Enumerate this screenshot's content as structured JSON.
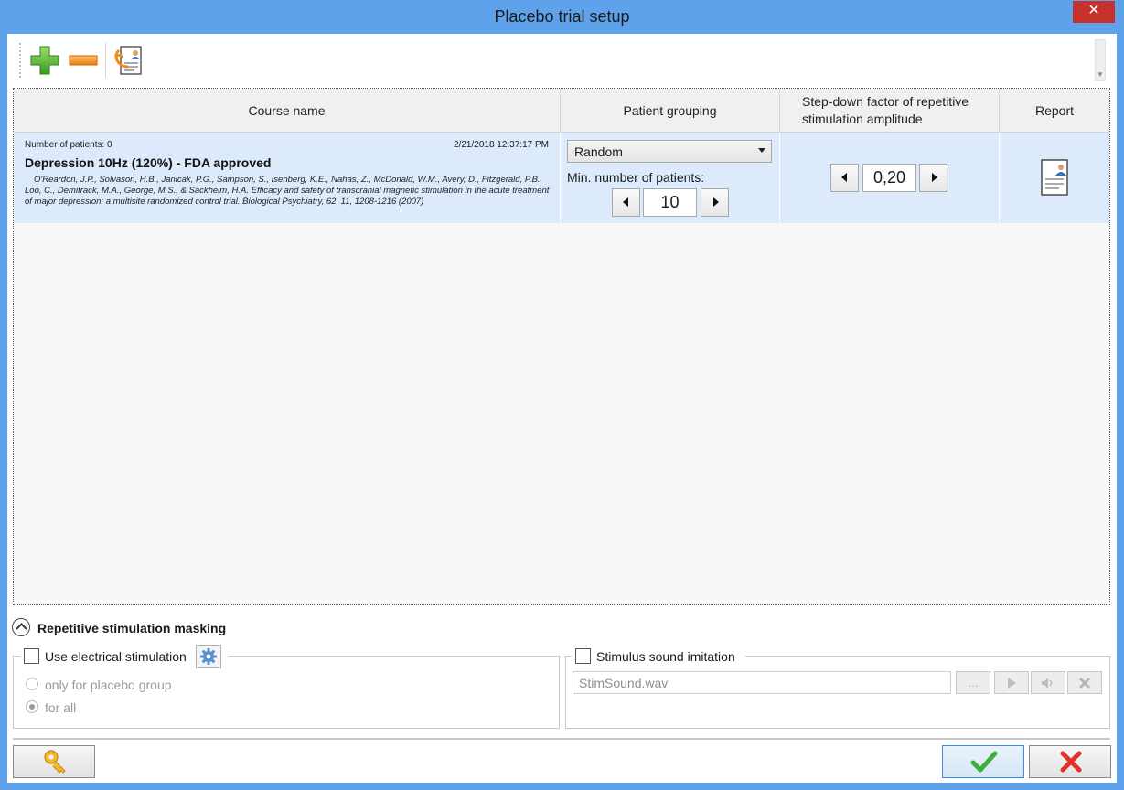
{
  "window": {
    "title": "Placebo trial setup",
    "close_glyph": "✕"
  },
  "toolbar": {
    "add_icon": "plus-icon",
    "remove_icon": "minus-icon",
    "patient_report_icon": "patient-report-icon"
  },
  "grid": {
    "columns": [
      "Course name",
      "Patient grouping",
      "Step-down factor of repetitive stimulation amplitude",
      "Report"
    ],
    "rows": [
      {
        "patients_label": "Number of patients:  0",
        "date": "2/21/2018 12:37:17 PM",
        "course_name": "Depression 10Hz (120%) - FDA approved",
        "citation": "O'Reardon, J.P., Solvason, H.B., Janicak, P.G., Sampson, S., Isenberg, K.E., Nahas, Z., McDonald, W.M., Avery, D., Fitzgerald, P.B., Loo, C., Demitrack, M.A., George, M.S., & Sackheim, H.A. Efficacy and safety of transcranial magnetic stimulation in the acute treatment of major depression: a multisite randomized control trial. Biological Psychiatry, 62, 11, 1208-1216 (2007)",
        "grouping": "Random",
        "min_patients_label": "Min. number of patients:",
        "min_patients": "10",
        "step_down": "0,20"
      }
    ]
  },
  "masking": {
    "title": "Repetitive stimulation masking",
    "electrical": {
      "label": "Use electrical stimulation",
      "options": [
        "only for placebo group",
        "for all"
      ],
      "selected": "for all"
    },
    "sound": {
      "label": "Stimulus sound imitation",
      "file": "StimSound.wav",
      "browse_label": "..."
    }
  },
  "footer": {
    "key_icon": "key-icon",
    "ok_icon": "checkmark-icon",
    "cancel_icon": "cross-icon"
  },
  "colors": {
    "accent": "#5da2ea",
    "row_selected": "#dceafc",
    "close": "#c7302b",
    "ok_green": "#3cae3c",
    "cancel_red": "#e0312b"
  }
}
